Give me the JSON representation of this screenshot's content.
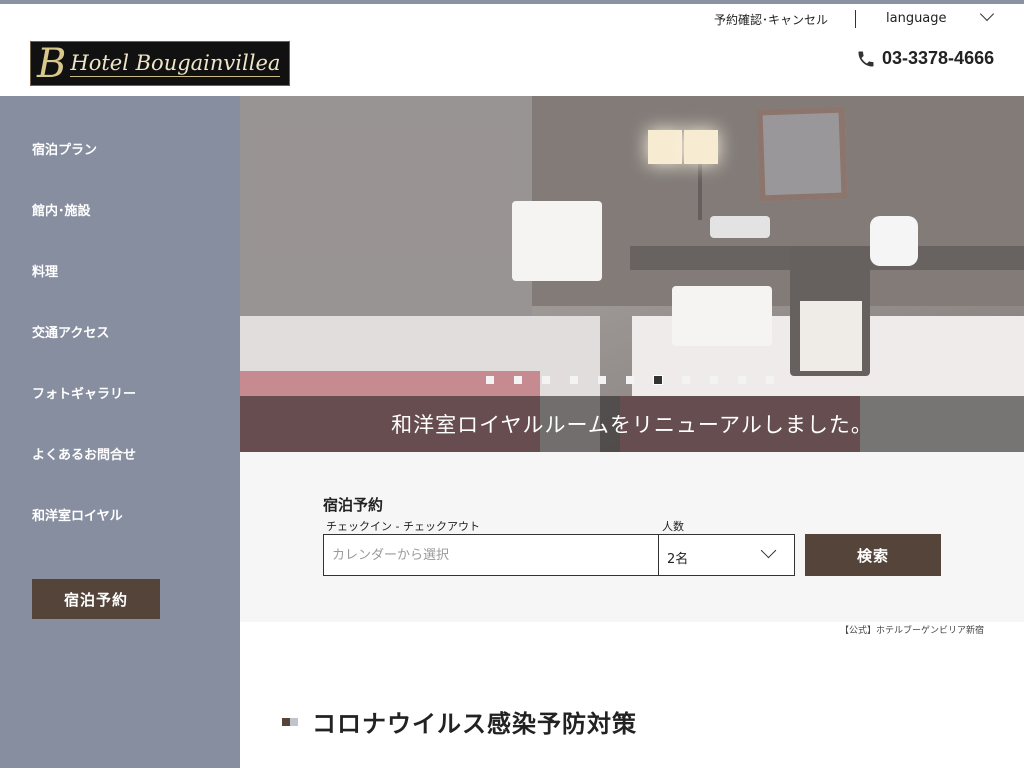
{
  "header": {
    "logo_initial": "B",
    "logo_text": "Hotel Bougainvillea",
    "confirm_cancel": "予約確認･キャンセル",
    "language": "language",
    "phone_number": "03-3378-4666"
  },
  "sidebar": {
    "items": [
      {
        "label": "宿泊プラン"
      },
      {
        "label": "館内･施設"
      },
      {
        "label": "料理"
      },
      {
        "label": "交通アクセス"
      },
      {
        "label": "フォトギャラリー"
      },
      {
        "label": "よくあるお問合せ"
      },
      {
        "label": "和洋室ロイヤル"
      }
    ],
    "reserve_button": "宿泊予約"
  },
  "hero": {
    "caption": "和洋室ロイヤルルームをリニューアルしました。",
    "slide_count": 11,
    "active_slide": 7
  },
  "booking": {
    "title": "宿泊予約",
    "date_label": "チェックイン - チェックアウト",
    "date_placeholder": "カレンダーから選択",
    "people_label": "人数",
    "people_value": "2名",
    "search_button": "検索"
  },
  "official_note": "【公式】ホテルブーゲンビリア新宿",
  "section": {
    "title": "コロナウイルス感染予防対策"
  },
  "colors": {
    "sidebar": "#868ea0",
    "button": "#54443a",
    "booking_bg": "#f6f6f6"
  }
}
